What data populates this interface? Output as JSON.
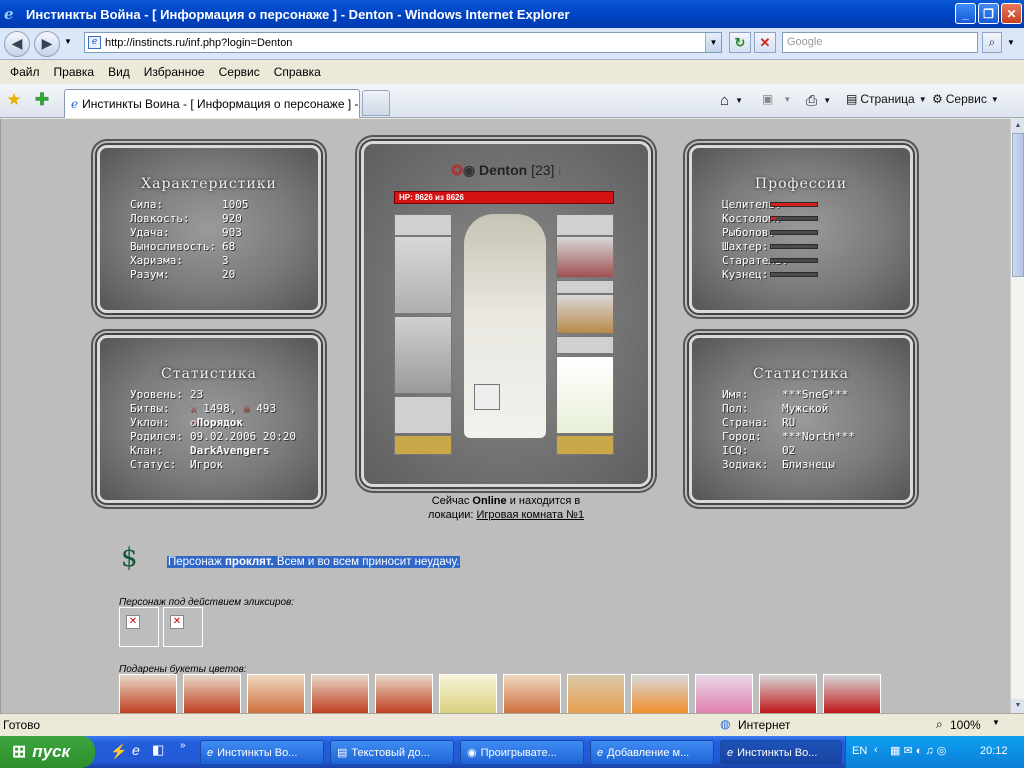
{
  "window": {
    "title": "Инстинкты Война - [ Информация о персонаже ] - Denton - Windows Internet Explorer",
    "icon": "ie-logo-icon",
    "minimize": "_",
    "maximize": "❐",
    "close": "✕"
  },
  "address": {
    "url": "http://instincts.ru/inf.php?login=Denton",
    "search_placeholder": "Google"
  },
  "menu": [
    "Файл",
    "Правка",
    "Вид",
    "Избранное",
    "Сервис",
    "Справка"
  ],
  "tab": {
    "label": "Инстинкты Воина - [ Информация о персонаже ] - ..."
  },
  "commandbar": {
    "page": "Страница",
    "tools": "Сервис"
  },
  "characteristics": {
    "title": "Характеристики",
    "rows": [
      {
        "k": "Сила:",
        "v": "1005"
      },
      {
        "k": "Ловкость:",
        "v": "920"
      },
      {
        "k": "Удача:",
        "v": "903"
      },
      {
        "k": "Выносливость:",
        "v": "68"
      },
      {
        "k": "Харизма:",
        "v": "3"
      },
      {
        "k": "Разум:",
        "v": "20"
      }
    ]
  },
  "statistics": {
    "title": "Статистика",
    "level_k": "Уровень:",
    "level_v": "23",
    "battles_k": "Битвы:",
    "wins": "1498,",
    "losses": "493",
    "align_k": "Уклон:",
    "align_v": "Порядок",
    "born_k": "Родился:",
    "born_v": "09.02.2006 20:20",
    "clan_k": "Клан:",
    "clan_v": "DarkAvengers",
    "status_k": "Статус:",
    "status_v": "Игрок"
  },
  "professions": {
    "title": "Профессии",
    "rows": [
      {
        "k": "Целитель:",
        "level": 1.0
      },
      {
        "k": "Костолом:",
        "level": 0.1
      },
      {
        "k": "Рыболов:",
        "level": 0.03
      },
      {
        "k": "Шахтер:",
        "level": 0.03
      },
      {
        "k": "Старатель:",
        "level": 0.03
      },
      {
        "k": "Кузнец:",
        "level": 0.03
      }
    ]
  },
  "personal": {
    "title": "Статистика",
    "rows": [
      {
        "k": "Имя:",
        "v": "***SneG***"
      },
      {
        "k": "Пол:",
        "v": "Мужской"
      },
      {
        "k": "Страна:",
        "v": "RU"
      },
      {
        "k": "Город:",
        "v": "***North***"
      },
      {
        "k": "ICQ:",
        "v": "02"
      },
      {
        "k": "Зодиак:",
        "v": "Близнецы"
      }
    ]
  },
  "character": {
    "name": "Denton",
    "level": "[23]",
    "hp": "HP: 8626 из 8626"
  },
  "location": {
    "prefix": "Сейчас",
    "online": "Online",
    "middle": "и находится в",
    "loc_label": "локации:",
    "place": "Игровая комната №1"
  },
  "curse": {
    "pre": "Персонаж",
    "bold": "проклят.",
    "post": "Всем и во всем приносит неудачу."
  },
  "elixirs_label": "Персонаж под действием эликсиров:",
  "flowers_label": "Подарены букеты цветов:",
  "statusbar": {
    "left": "Готово",
    "zone": "Интернет",
    "zoom": "100%"
  },
  "taskbar": {
    "start": "пуск",
    "tasks": [
      "Инстинкты Во...",
      "Текстовый до...",
      "Проигрывате...",
      "Добавление м...",
      "Инстинкты Во..."
    ],
    "lang": "EN",
    "clock": "20:12"
  }
}
